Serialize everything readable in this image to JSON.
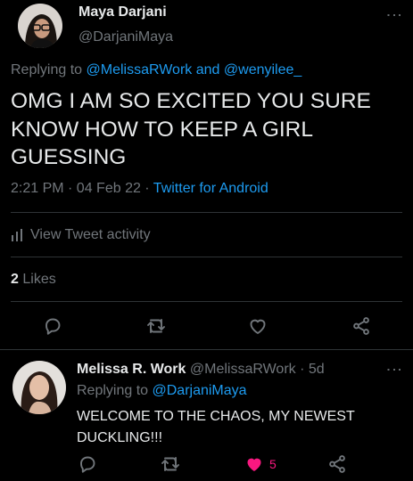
{
  "main_tweet": {
    "author_name": "Maya Darjani",
    "author_handle": "@DarjaniMaya",
    "replying_prefix": "Replying to",
    "reply_handle_1": "@MelissaRWork",
    "reply_and": "and",
    "reply_handle_2": "@wenyilee_",
    "text": "OMG I AM SO EXCITED YOU SURE KNOW HOW TO KEEP A GIRL GUESSING",
    "time_date": "2:21 PM · 04 Feb 22 ·",
    "source": "Twitter for Android",
    "activity_label": "View Tweet activity",
    "likes_count": "2",
    "likes_label": "Likes"
  },
  "reply_tweet": {
    "author_name": "Melissa R. Work",
    "author_handle": "@MelissaRWork",
    "age": "· 5d",
    "replying_prefix": "Replying to",
    "reply_handle": "@DarjaniMaya",
    "text": "WELCOME TO THE CHAOS, MY NEWEST DUCKLING!!!",
    "like_count": "5"
  },
  "colors": {
    "accent": "#1d9bf0",
    "like": "#f91880",
    "muted": "#71767b"
  }
}
